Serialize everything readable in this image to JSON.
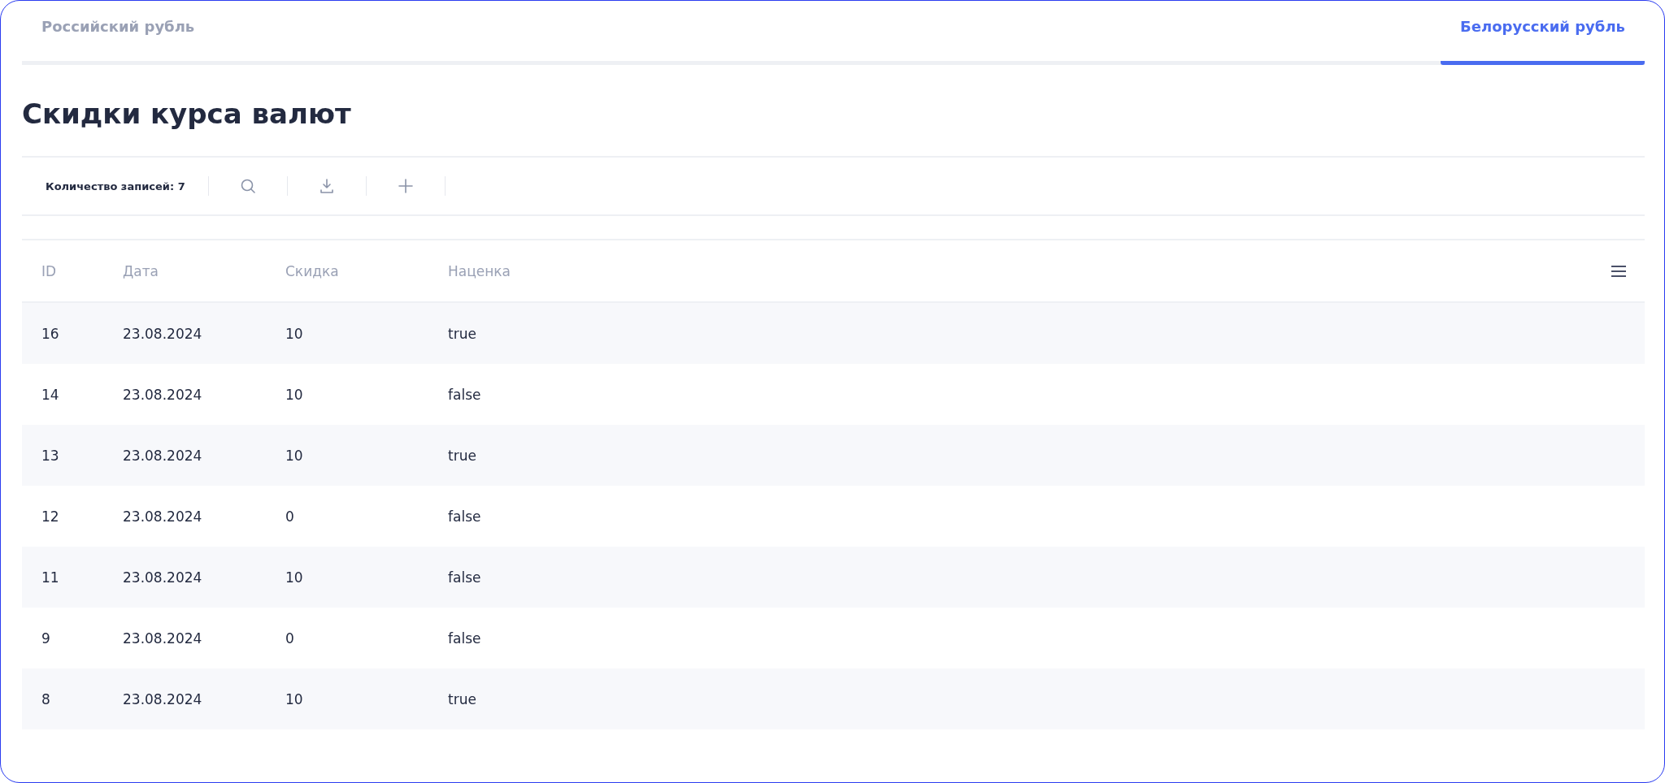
{
  "tabs": [
    {
      "label": "Российский рубль",
      "selected": false
    },
    {
      "label": "Белорусский рубль",
      "selected": true
    }
  ],
  "title": "Скидки курса валют",
  "toolbar": {
    "record_count": "Количество записей: 7"
  },
  "table": {
    "columns": [
      "ID",
      "Дата",
      "Скидка",
      "Наценка"
    ],
    "rows": [
      [
        "16",
        "23.08.2024",
        "10",
        "true"
      ],
      [
        "14",
        "23.08.2024",
        "10",
        "false"
      ],
      [
        "13",
        "23.08.2024",
        "10",
        "true"
      ],
      [
        "12",
        "23.08.2024",
        "0",
        "false"
      ],
      [
        "11",
        "23.08.2024",
        "10",
        "false"
      ],
      [
        "9",
        "23.08.2024",
        "0",
        "false"
      ],
      [
        "8",
        "23.08.2024",
        "10",
        "true"
      ]
    ]
  }
}
